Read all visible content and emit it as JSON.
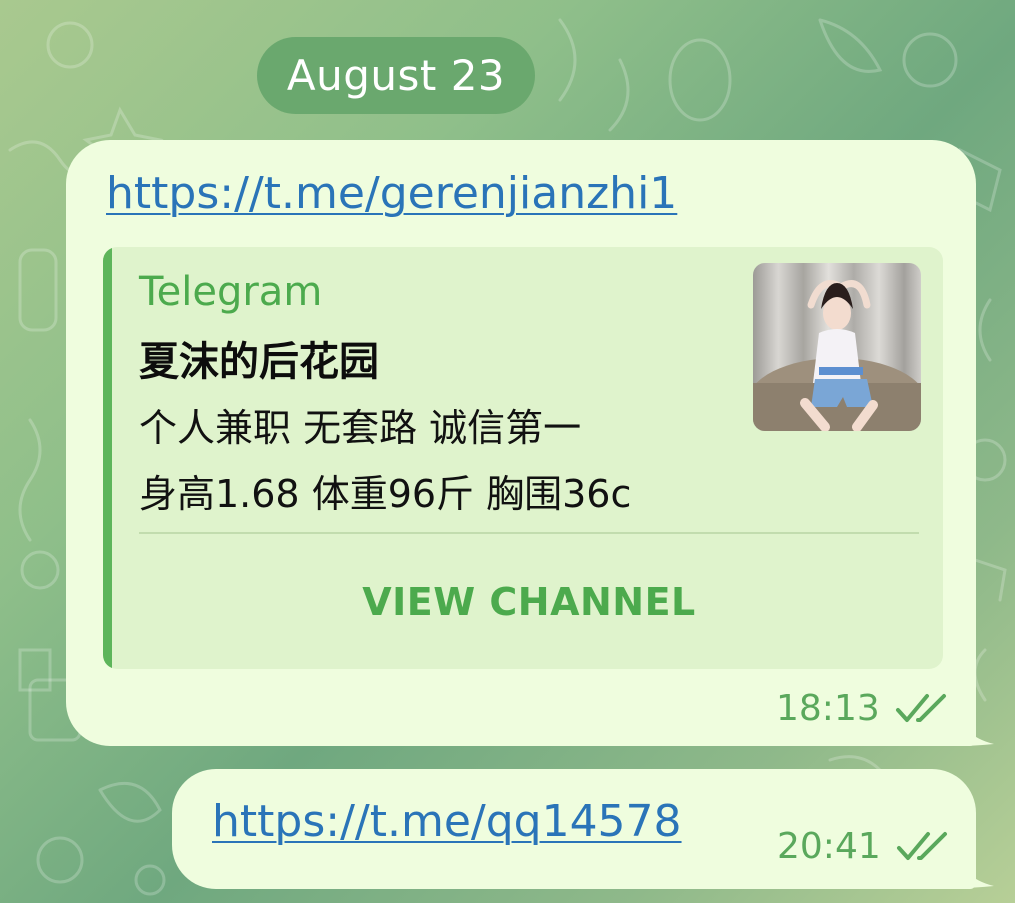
{
  "chat": {
    "date_label": "August 23",
    "messages": [
      {
        "link": "https://t.me/gerenjianzhi1",
        "preview": {
          "site_name": "Telegram",
          "title": "夏沫的后花园",
          "description_lines": [
            "个人兼职 无套路 诚信第一",
            "身高1.68 体重96斤 胸围36c"
          ],
          "button_label": "VIEW CHANNEL"
        },
        "time": "18:13",
        "status_icon": "double-check-icon"
      },
      {
        "link": "https://t.me/qq14578",
        "time": "20:41",
        "status_icon": "double-check-icon"
      }
    ]
  },
  "colors": {
    "bubble": "#effdde",
    "link": "#2a74b8",
    "accent": "#4caa4d",
    "date_pill": "#6aa86e"
  }
}
